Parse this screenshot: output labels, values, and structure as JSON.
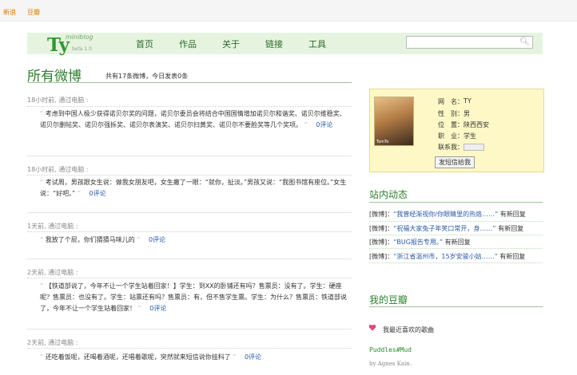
{
  "topbar": {
    "link1": "新浪",
    "link2": "豆瓣"
  },
  "logo": {
    "main": "Ty",
    "sub": "miniblog",
    "beta": "beta 1.0"
  },
  "nav": [
    "首页",
    "作品",
    "关于",
    "链接",
    "工具"
  ],
  "search": {
    "placeholder": ""
  },
  "page": {
    "title": "所有微博",
    "stats": "共有17条微博，今日发表0条"
  },
  "posts": [
    {
      "meta": "18小时前, 通过电脑 :",
      "text": "考虑到中国人极少获得诺贝尔奖的问题，诺贝尔委员会将结合中国国情增加诺贝尔和谐奖、诺贝尔维稳奖、诺贝尔删帖奖、诺贝尔强拆奖、诺贝尔表演奖、诺贝尔扫黄奖、诺贝尔不要脸奖等几个奖项。",
      "comment": "0评论"
    },
    {
      "meta": "18小时前, 通过电脑 :",
      "text": "考试周，男孩跟女生说：做我女朋友吧，女生撇了一眼：“就你，扯淡。”男孩又说：“我图书馆有座位。”女生说：“好吧。”",
      "comment": "0评论"
    },
    {
      "meta": "1天前, 通过电脑 :",
      "text": "我放了个屁，你们猜猜马味儿的",
      "comment": "0评论"
    },
    {
      "meta": "2天前, 通过电脑 :",
      "text": "【铁道部说了，今年不让一个学生站着回家！】学生：到XX的卧铺还有吗？售票员：没有了。学生：硬座呢？售票员：也没有了。学生：站票还有吗？售票员：有，但不售学生票。学生：为什么？售票员：铁道部说了，今年不让一个学生站着回家！",
      "comment": "0评论"
    },
    {
      "meta": "2天前, 通过电脑 :",
      "text": "还吃着饭呢，还喝着酒呢，还唱着歌呢，突然就来短信说你挂科了",
      "comment": "0评论"
    }
  ],
  "profile": {
    "avatar_caption": "TomTo",
    "labels": [
      "网　名：",
      "性　别：",
      "位　置：",
      "职　业：",
      "联系我："
    ],
    "values": [
      "TY",
      "男",
      "陕西西安",
      "学生"
    ],
    "contact_icon": "im-status-icon",
    "button": "发短信给我"
  },
  "news": {
    "title": "站内动态",
    "items": [
      {
        "tag": "[微博]：",
        "link": "“我曾经渐视你/你眼睛里的热烙……”",
        "suffix": "有新回复"
      },
      {
        "tag": "[微博]：",
        "link": "“祝福大家兔子年笑口常开，身……”",
        "suffix": "有新回复"
      },
      {
        "tag": "[微博]：",
        "link": "“BUG报告专用。”",
        "suffix": "有新回复"
      },
      {
        "tag": "[微博]：",
        "link": "“浙江省温州市，15岁安骏小姑……”",
        "suffix": "有新回复"
      }
    ]
  },
  "douban": {
    "title": "我的豆瓣",
    "favorite": "我最近喜欢的歌曲",
    "song": "Puddles#Mud",
    "artist": "by Agnes Kain."
  },
  "colors": {
    "accent": "#2e7f2e",
    "header_bg": "#e6f4df",
    "profile_bg": "#fdf8c6",
    "link": "#2a5aa8",
    "topbar_link": "#e07b00"
  }
}
